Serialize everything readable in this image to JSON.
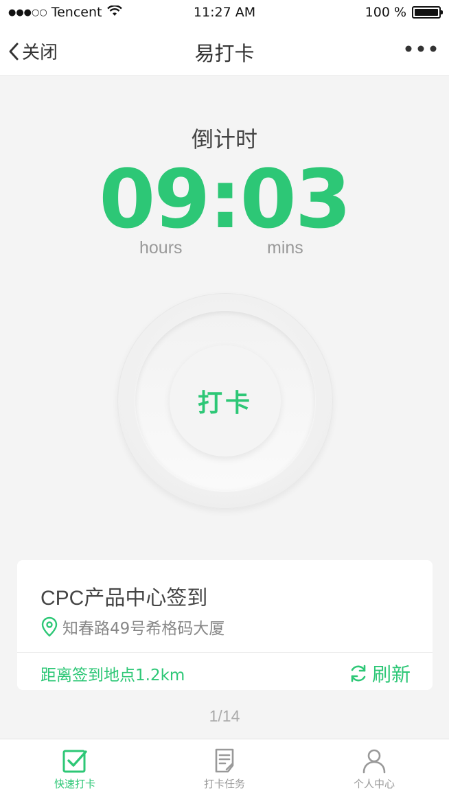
{
  "status_bar": {
    "carrier": "Tencent",
    "time": "11:27 AM",
    "battery": "100 %"
  },
  "nav": {
    "back_label": "关闭",
    "title": "易打卡"
  },
  "countdown": {
    "label": "倒计时",
    "time": "09:03",
    "hours_unit": "hours",
    "mins_unit": "mins"
  },
  "punch_button": {
    "label": "打卡"
  },
  "card": {
    "title": "CPC产品中心签到",
    "address": "知春路49号希格码大厦",
    "distance": "距离签到地点1.2km",
    "refresh_label": "刷新"
  },
  "pager": "1/14",
  "tabs": [
    {
      "label": "快速打卡",
      "icon": "check-square-icon",
      "active": true
    },
    {
      "label": "打卡任务",
      "icon": "task-doc-icon",
      "active": false
    },
    {
      "label": "个人中心",
      "icon": "user-icon",
      "active": false
    }
  ],
  "colors": {
    "accent": "#2dc776",
    "background": "#f4f4f4",
    "inactive": "#999999"
  }
}
